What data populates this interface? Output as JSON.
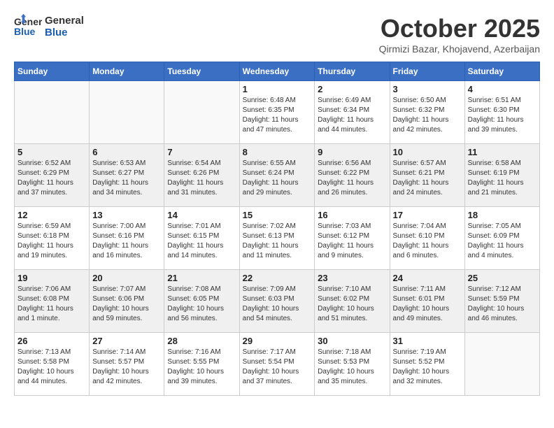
{
  "header": {
    "logo_line1": "General",
    "logo_line2": "Blue",
    "month_title": "October 2025",
    "location": "Qirmizi Bazar, Khojavend, Azerbaijan"
  },
  "weekdays": [
    "Sunday",
    "Monday",
    "Tuesday",
    "Wednesday",
    "Thursday",
    "Friday",
    "Saturday"
  ],
  "weeks": [
    [
      {
        "day": "",
        "info": ""
      },
      {
        "day": "",
        "info": ""
      },
      {
        "day": "",
        "info": ""
      },
      {
        "day": "1",
        "info": "Sunrise: 6:48 AM\nSunset: 6:35 PM\nDaylight: 11 hours\nand 47 minutes."
      },
      {
        "day": "2",
        "info": "Sunrise: 6:49 AM\nSunset: 6:34 PM\nDaylight: 11 hours\nand 44 minutes."
      },
      {
        "day": "3",
        "info": "Sunrise: 6:50 AM\nSunset: 6:32 PM\nDaylight: 11 hours\nand 42 minutes."
      },
      {
        "day": "4",
        "info": "Sunrise: 6:51 AM\nSunset: 6:30 PM\nDaylight: 11 hours\nand 39 minutes."
      }
    ],
    [
      {
        "day": "5",
        "info": "Sunrise: 6:52 AM\nSunset: 6:29 PM\nDaylight: 11 hours\nand 37 minutes."
      },
      {
        "day": "6",
        "info": "Sunrise: 6:53 AM\nSunset: 6:27 PM\nDaylight: 11 hours\nand 34 minutes."
      },
      {
        "day": "7",
        "info": "Sunrise: 6:54 AM\nSunset: 6:26 PM\nDaylight: 11 hours\nand 31 minutes."
      },
      {
        "day": "8",
        "info": "Sunrise: 6:55 AM\nSunset: 6:24 PM\nDaylight: 11 hours\nand 29 minutes."
      },
      {
        "day": "9",
        "info": "Sunrise: 6:56 AM\nSunset: 6:22 PM\nDaylight: 11 hours\nand 26 minutes."
      },
      {
        "day": "10",
        "info": "Sunrise: 6:57 AM\nSunset: 6:21 PM\nDaylight: 11 hours\nand 24 minutes."
      },
      {
        "day": "11",
        "info": "Sunrise: 6:58 AM\nSunset: 6:19 PM\nDaylight: 11 hours\nand 21 minutes."
      }
    ],
    [
      {
        "day": "12",
        "info": "Sunrise: 6:59 AM\nSunset: 6:18 PM\nDaylight: 11 hours\nand 19 minutes."
      },
      {
        "day": "13",
        "info": "Sunrise: 7:00 AM\nSunset: 6:16 PM\nDaylight: 11 hours\nand 16 minutes."
      },
      {
        "day": "14",
        "info": "Sunrise: 7:01 AM\nSunset: 6:15 PM\nDaylight: 11 hours\nand 14 minutes."
      },
      {
        "day": "15",
        "info": "Sunrise: 7:02 AM\nSunset: 6:13 PM\nDaylight: 11 hours\nand 11 minutes."
      },
      {
        "day": "16",
        "info": "Sunrise: 7:03 AM\nSunset: 6:12 PM\nDaylight: 11 hours\nand 9 minutes."
      },
      {
        "day": "17",
        "info": "Sunrise: 7:04 AM\nSunset: 6:10 PM\nDaylight: 11 hours\nand 6 minutes."
      },
      {
        "day": "18",
        "info": "Sunrise: 7:05 AM\nSunset: 6:09 PM\nDaylight: 11 hours\nand 4 minutes."
      }
    ],
    [
      {
        "day": "19",
        "info": "Sunrise: 7:06 AM\nSunset: 6:08 PM\nDaylight: 11 hours\nand 1 minute."
      },
      {
        "day": "20",
        "info": "Sunrise: 7:07 AM\nSunset: 6:06 PM\nDaylight: 10 hours\nand 59 minutes."
      },
      {
        "day": "21",
        "info": "Sunrise: 7:08 AM\nSunset: 6:05 PM\nDaylight: 10 hours\nand 56 minutes."
      },
      {
        "day": "22",
        "info": "Sunrise: 7:09 AM\nSunset: 6:03 PM\nDaylight: 10 hours\nand 54 minutes."
      },
      {
        "day": "23",
        "info": "Sunrise: 7:10 AM\nSunset: 6:02 PM\nDaylight: 10 hours\nand 51 minutes."
      },
      {
        "day": "24",
        "info": "Sunrise: 7:11 AM\nSunset: 6:01 PM\nDaylight: 10 hours\nand 49 minutes."
      },
      {
        "day": "25",
        "info": "Sunrise: 7:12 AM\nSunset: 5:59 PM\nDaylight: 10 hours\nand 46 minutes."
      }
    ],
    [
      {
        "day": "26",
        "info": "Sunrise: 7:13 AM\nSunset: 5:58 PM\nDaylight: 10 hours\nand 44 minutes."
      },
      {
        "day": "27",
        "info": "Sunrise: 7:14 AM\nSunset: 5:57 PM\nDaylight: 10 hours\nand 42 minutes."
      },
      {
        "day": "28",
        "info": "Sunrise: 7:16 AM\nSunset: 5:55 PM\nDaylight: 10 hours\nand 39 minutes."
      },
      {
        "day": "29",
        "info": "Sunrise: 7:17 AM\nSunset: 5:54 PM\nDaylight: 10 hours\nand 37 minutes."
      },
      {
        "day": "30",
        "info": "Sunrise: 7:18 AM\nSunset: 5:53 PM\nDaylight: 10 hours\nand 35 minutes."
      },
      {
        "day": "31",
        "info": "Sunrise: 7:19 AM\nSunset: 5:52 PM\nDaylight: 10 hours\nand 32 minutes."
      },
      {
        "day": "",
        "info": ""
      }
    ]
  ]
}
